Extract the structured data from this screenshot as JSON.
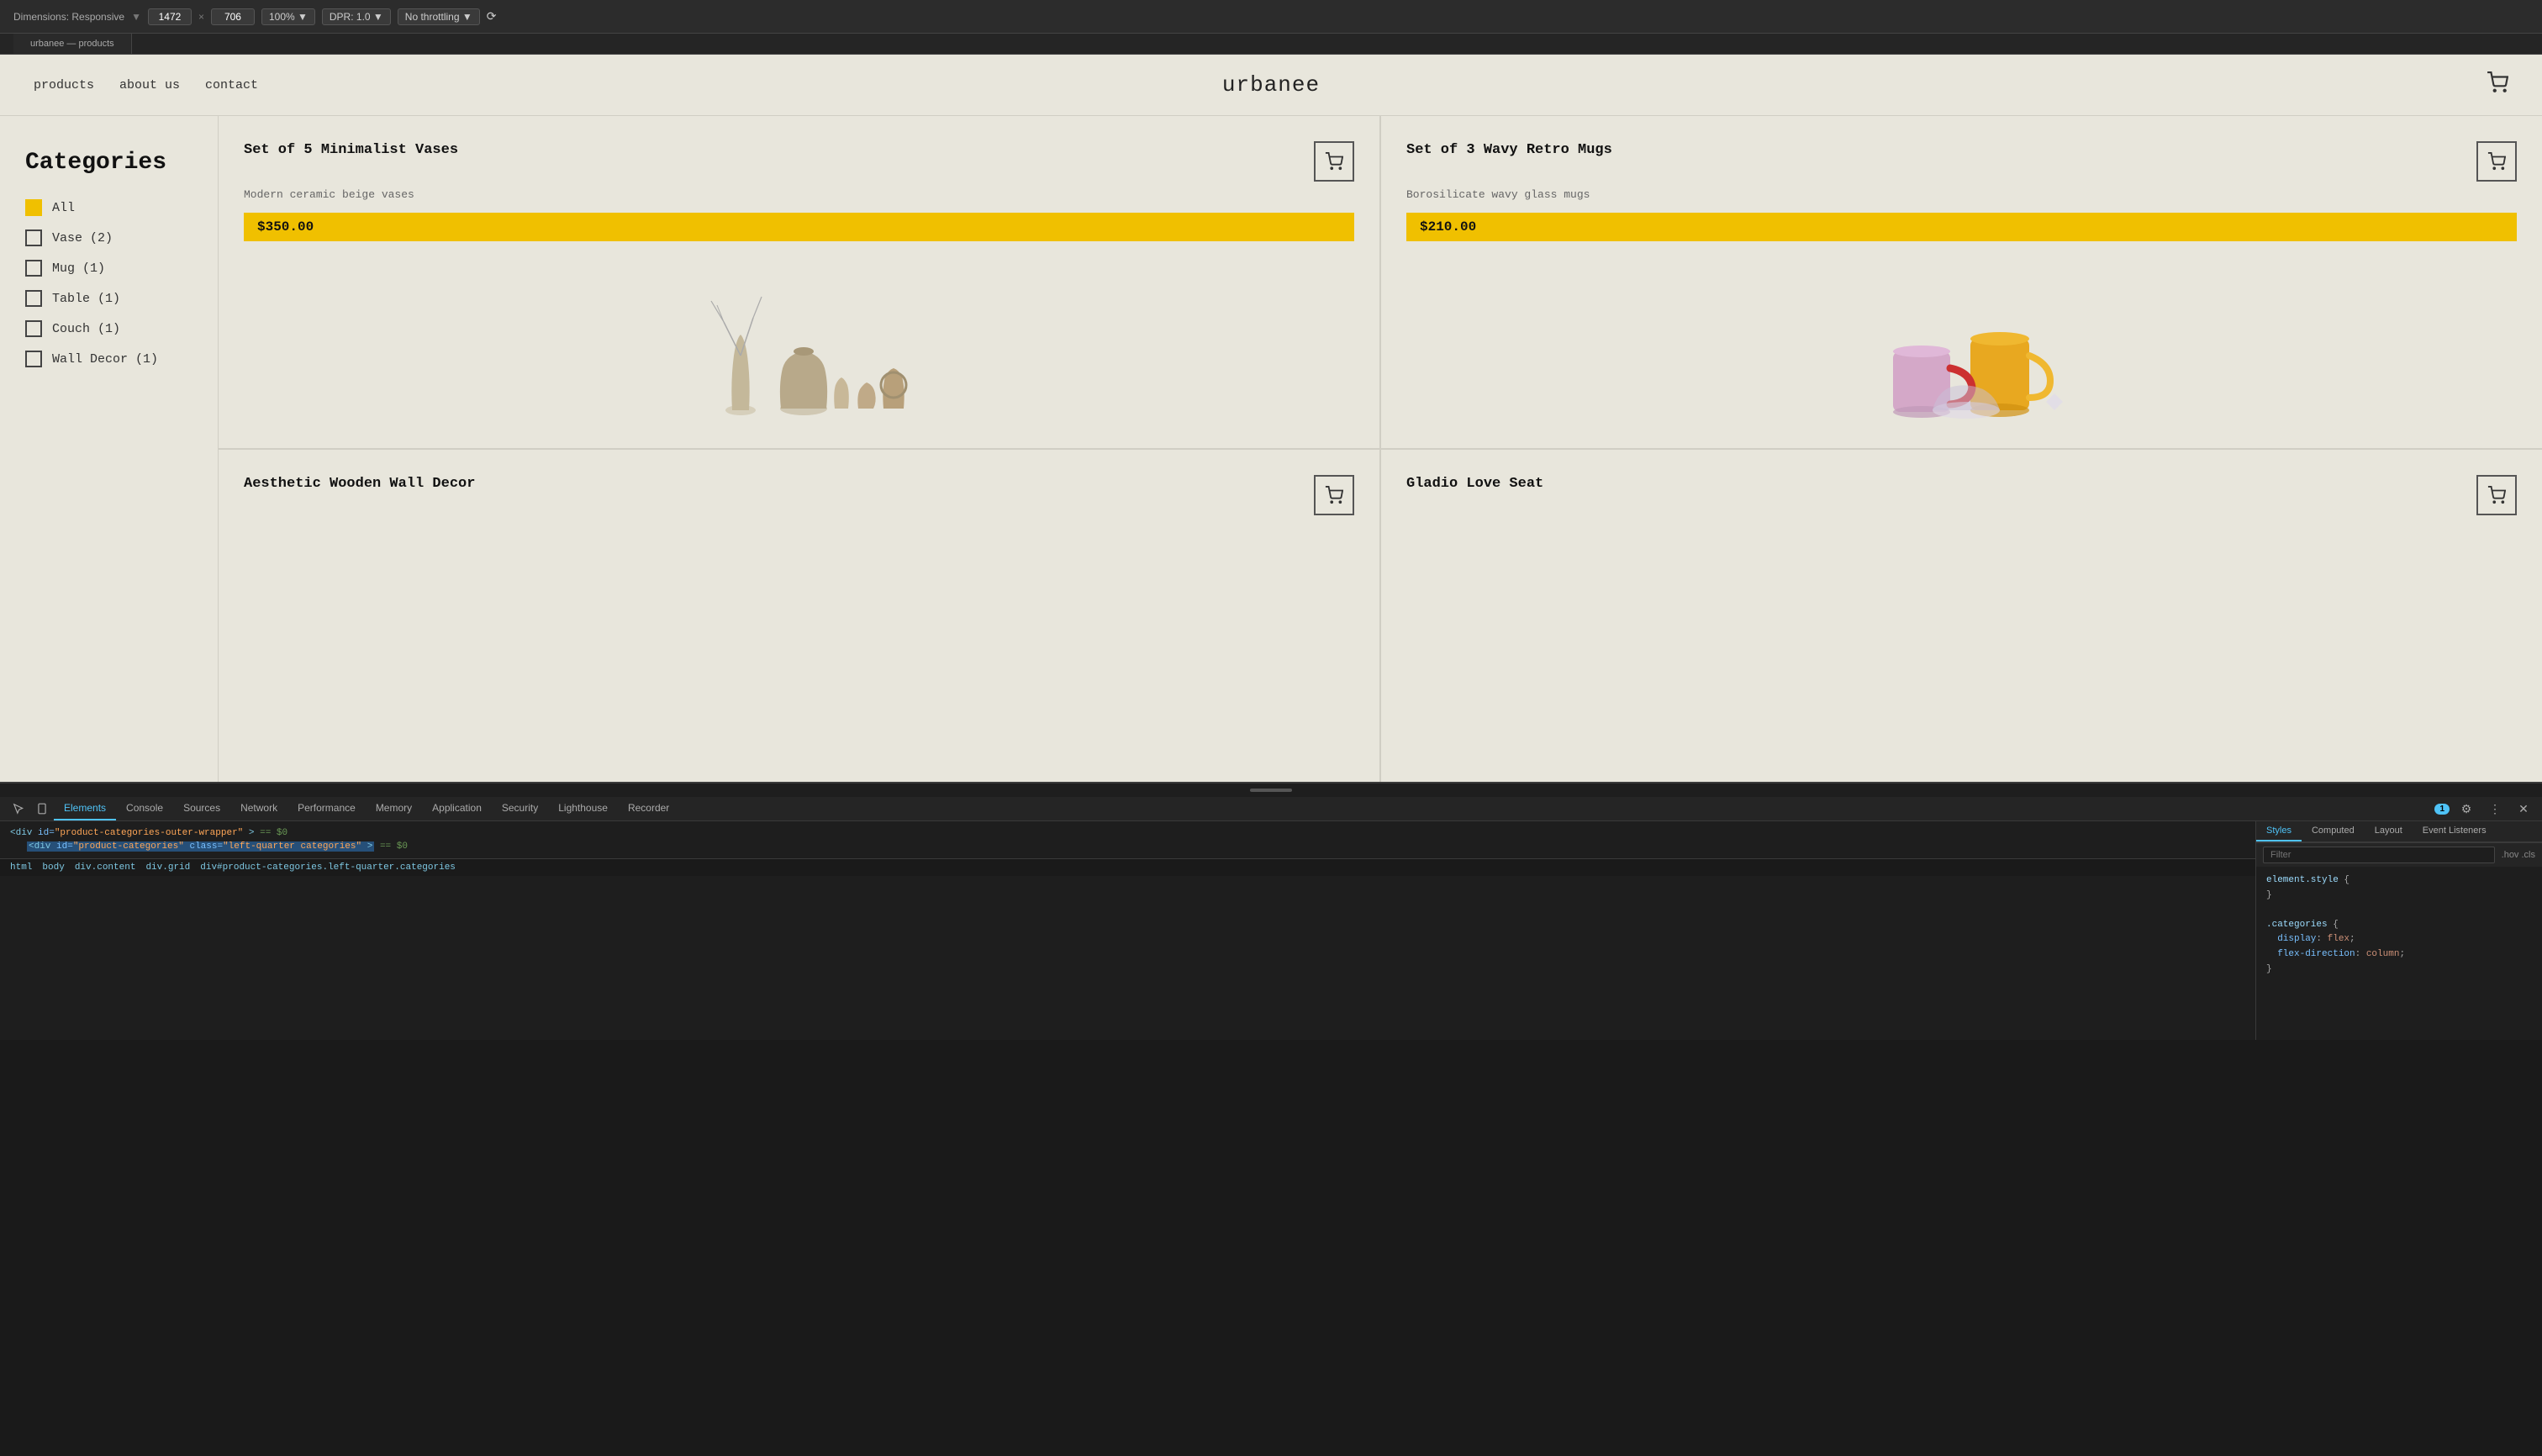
{
  "browser": {
    "dimensions_label": "Dimensions: Responsive",
    "width": "1472",
    "height": "706",
    "zoom": "100%",
    "dpr": "DPR: 1.0",
    "throttle": "No throttling"
  },
  "site": {
    "title": "urbanee",
    "nav": {
      "links": [
        "products",
        "about us",
        "contact"
      ]
    },
    "sidebar": {
      "title": "Categories",
      "categories": [
        {
          "label": "All",
          "checked": true
        },
        {
          "label": "Vase (2)",
          "checked": false
        },
        {
          "label": "Mug (1)",
          "checked": false
        },
        {
          "label": "Table (1)",
          "checked": false
        },
        {
          "label": "Couch (1)",
          "checked": false
        },
        {
          "label": "Wall Decor (1)",
          "checked": false
        }
      ]
    },
    "products": [
      {
        "name": "Set of 5 Minimalist Vases",
        "desc": "Modern ceramic beige vases",
        "price": "$350.00"
      },
      {
        "name": "Set of 3 Wavy Retro Mugs",
        "desc": "Borosilicate wavy glass mugs",
        "price": "$210.00"
      },
      {
        "name": "Aesthetic Wooden Wall Decor",
        "desc": "",
        "price": ""
      },
      {
        "name": "Gladio Love Seat",
        "desc": "",
        "price": ""
      }
    ]
  },
  "devtools": {
    "tabs": [
      "Elements",
      "Console",
      "Sources",
      "Network",
      "Performance",
      "Memory",
      "Application",
      "Security",
      "Lighthouse",
      "Recorder"
    ],
    "active_tab": "Elements",
    "breadcrumb": [
      "html",
      "body",
      "div.content",
      "div.grid",
      "div#product-categories.left-quarter.categories"
    ],
    "selected_element": "<div id=\"product-categories\" class=\"left-quarter categories\">",
    "html_lines": [
      "▶ <div id=\"product-categories-outer-wrapper\"> == $0",
      "  ▶ <div id=\"product-categories\" class=\"left-quarter categories\"> == $0"
    ],
    "right_tabs": [
      "Styles",
      "Computed",
      "Layout",
      "Event Listeners"
    ],
    "active_right_tab": "Styles",
    "filter_placeholder": "Filter",
    "cls_label": ".hov  .cls",
    "styles_content": [
      "element.style {",
      "}",
      ".categories {",
      "  display: flex;",
      "  flex-direction: column;",
      "}"
    ],
    "computed_label": "Computed",
    "bottom_icons": [
      "cursor",
      "device",
      "dots"
    ],
    "count_badge": "1"
  }
}
